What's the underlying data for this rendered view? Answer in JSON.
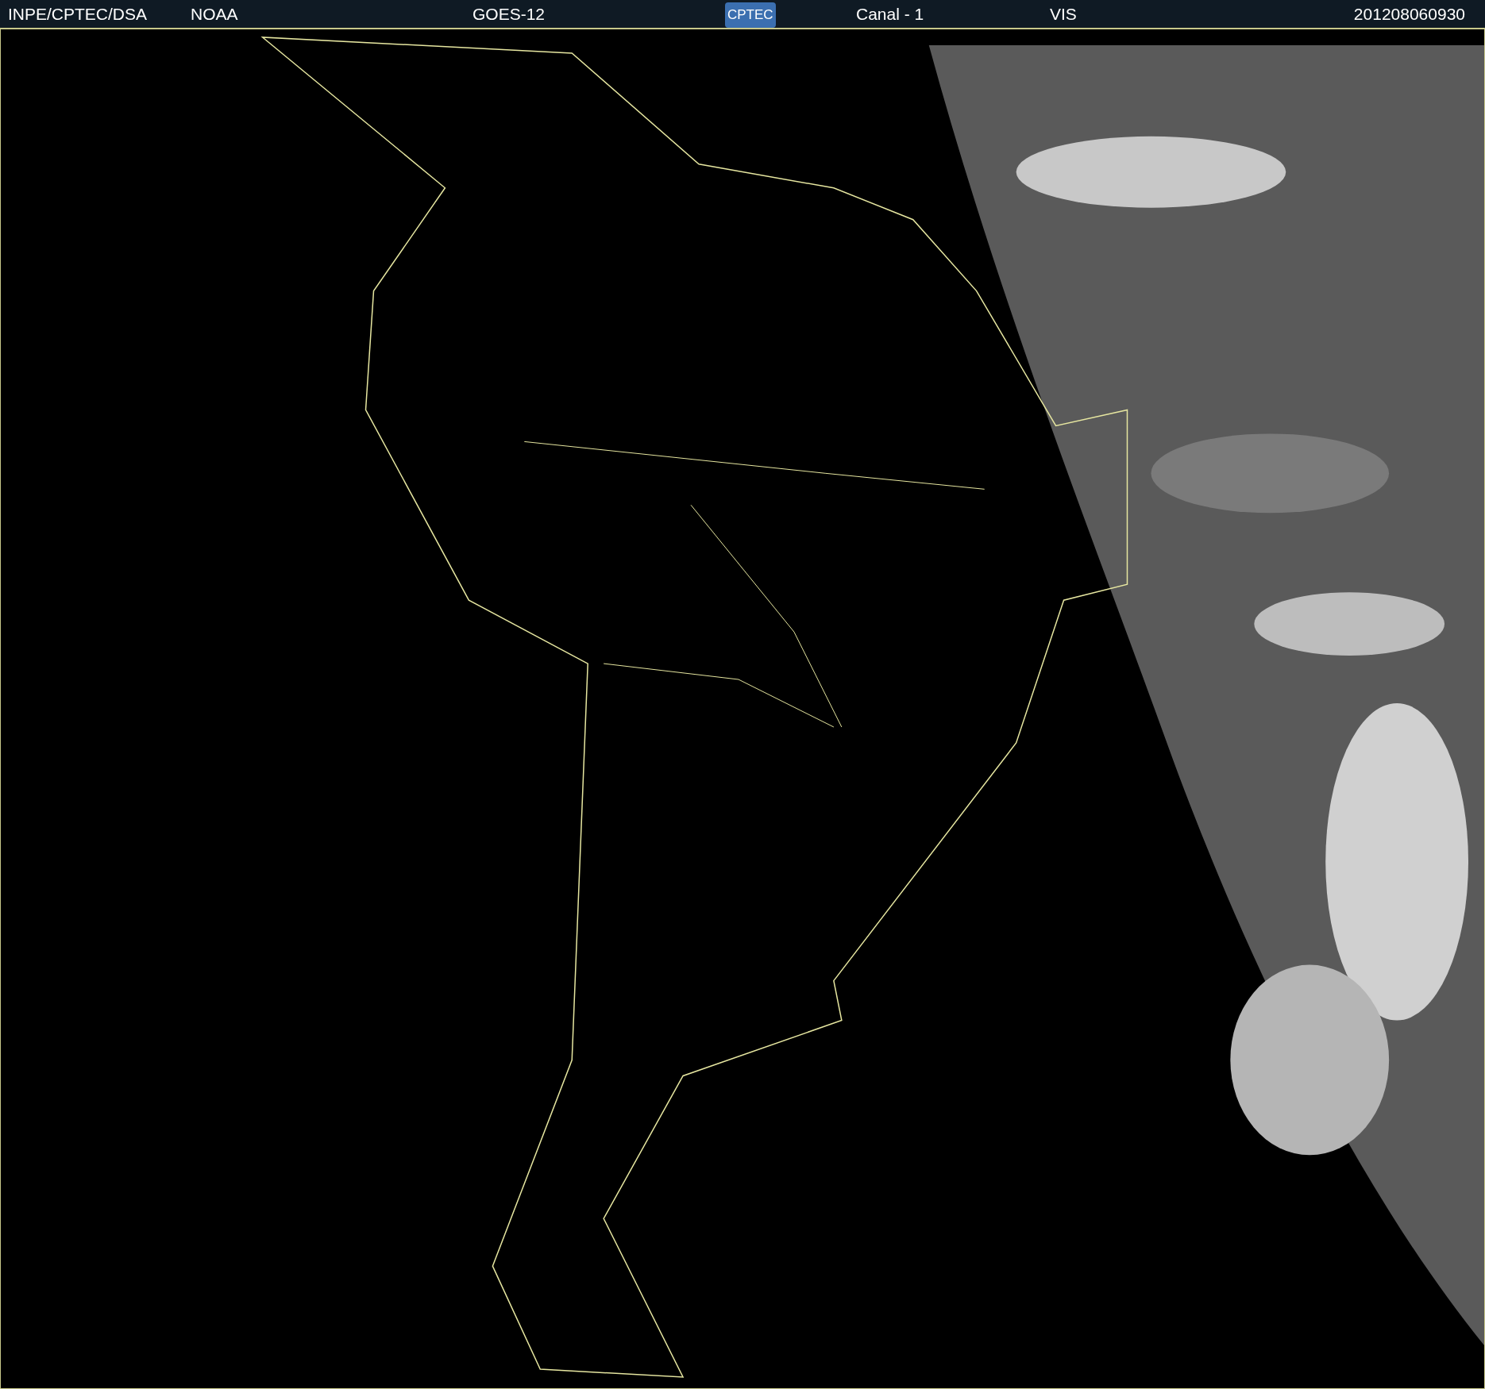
{
  "header": {
    "left_labels": [
      "INPE/CPTEC/DSA",
      "NOAA"
    ],
    "satellite": "GOES-12",
    "logo": "CPTEC",
    "channel": "Canal - 1",
    "band": "VIS",
    "timestamp": "201208060930"
  }
}
